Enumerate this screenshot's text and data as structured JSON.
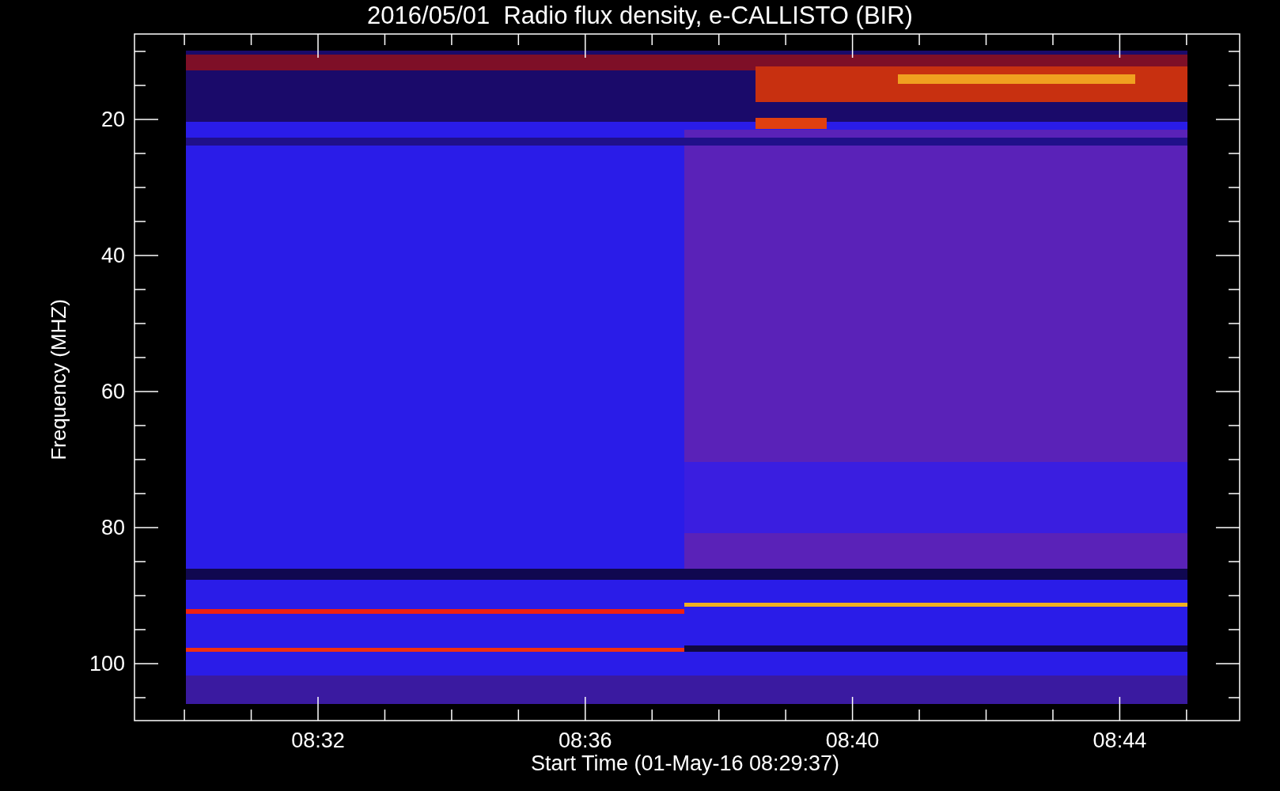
{
  "plot": {
    "title": "2016/05/01  Radio flux density, e-CALLISTO (BIR)",
    "y_label": "Frequency (MHZ)",
    "x_label": "Start Time (01-May-16 08:29:37)",
    "y_tick_labels": [
      "20",
      "40",
      "60",
      "80",
      "100"
    ],
    "x_tick_labels": [
      "08:32",
      "08:36",
      "08:40",
      "08:44"
    ]
  }
}
